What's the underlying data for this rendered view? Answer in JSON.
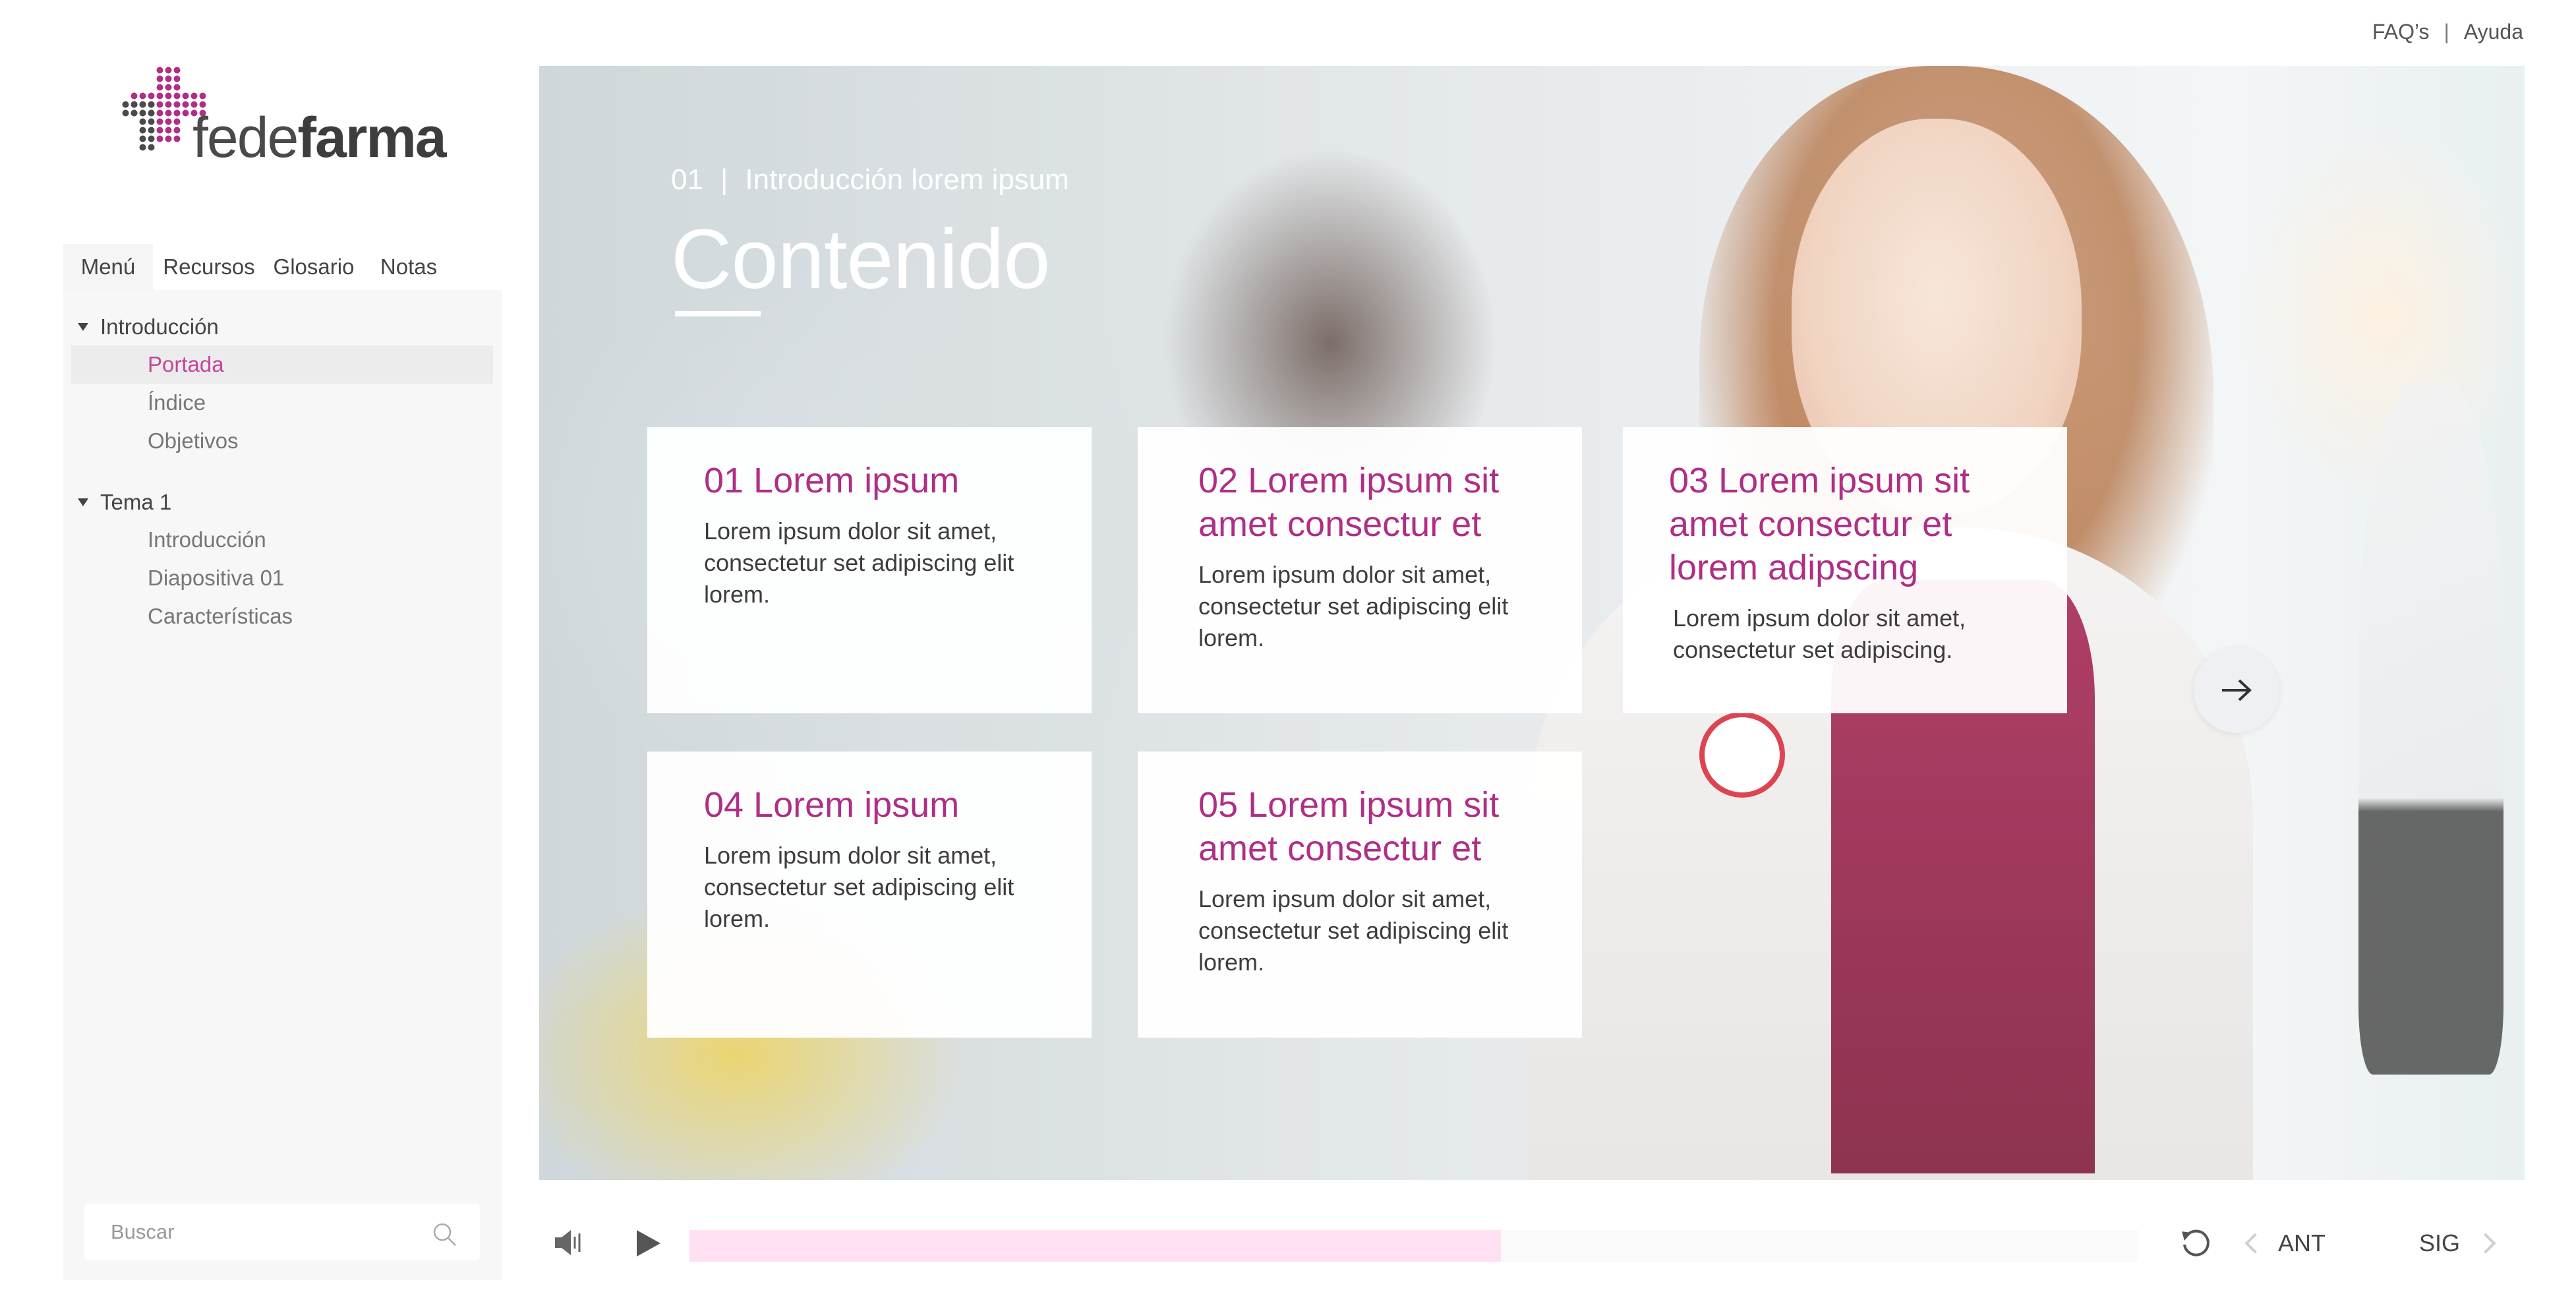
{
  "top_links": {
    "faq": "FAQ’s",
    "separator": "|",
    "help": "Ayuda"
  },
  "logo": {
    "name_light": "fede",
    "name_bold": "farma",
    "brand_color": "#b02e86"
  },
  "sidebar": {
    "tabs": [
      {
        "label": "Menú",
        "active": true
      },
      {
        "label": "Recursos"
      },
      {
        "label": "Glosario"
      },
      {
        "label": "Notas"
      }
    ],
    "groups": [
      {
        "label": "Introducción",
        "expanded": true,
        "items": [
          {
            "label": "Portada",
            "current": true
          },
          {
            "label": "Índice"
          },
          {
            "label": "Objetivos"
          }
        ]
      },
      {
        "label": "Tema 1",
        "expanded": true,
        "items": [
          {
            "label": "Introducción"
          },
          {
            "label": "Diapositiva 01"
          },
          {
            "label": "Características"
          }
        ]
      }
    ],
    "search": {
      "placeholder": "Buscar",
      "icon": "search-icon"
    }
  },
  "slide": {
    "number": "01",
    "separator": "|",
    "section": "Introducción lorem ipsum",
    "title": "Contenido",
    "cards": [
      {
        "title": "01 Lorem ipsum",
        "text": "Lorem ipsum dolor sit amet, consectetur set adipiscing elit lorem."
      },
      {
        "title": "02 Lorem ipsum sit amet consectur et",
        "text": "Lorem ipsum dolor sit amet, consectetur set adipiscing elit lorem."
      },
      {
        "title": "03 Lorem ipsum sit amet consectur et lorem adipscing",
        "text": "Lorem ipsum dolor sit amet, consectetur set adipiscing."
      },
      {
        "title": "04 Lorem ipsum",
        "text": "Lorem ipsum dolor sit amet, consectetur set adipiscing elit lorem."
      },
      {
        "title": "05 Lorem ipsum sit amet consectur et",
        "text": "Lorem ipsum dolor sit amet, consectetur set adipiscing elit lorem."
      }
    ],
    "next_icon": "arrow-right-icon"
  },
  "player": {
    "progress": 0.56,
    "progress_color": "#ffe0f2",
    "prev_label": "ANT",
    "next_label": "SIG",
    "icons": [
      "volume-icon",
      "play-icon",
      "replay-icon",
      "chevron-left-icon",
      "chevron-right-icon"
    ]
  },
  "colors": {
    "accent": "#b02e86",
    "current_item": "#c5459a"
  }
}
